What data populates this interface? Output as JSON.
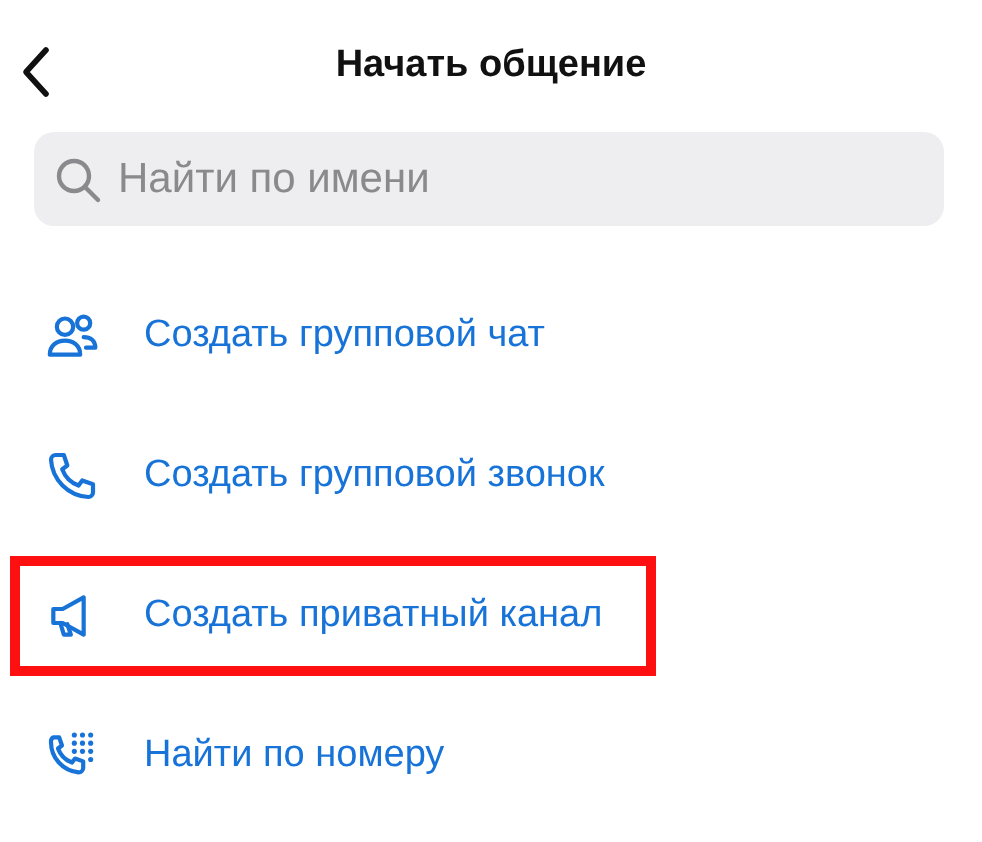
{
  "header": {
    "title": "Начать общение"
  },
  "search": {
    "placeholder": "Найти по имени"
  },
  "actions": [
    {
      "kind": "group",
      "label": "Создать групповой чат",
      "highlighted": false
    },
    {
      "kind": "call",
      "label": "Создать групповой звонок",
      "highlighted": false
    },
    {
      "kind": "channel",
      "label": "Создать приватный канал",
      "highlighted": true
    },
    {
      "kind": "dial",
      "label": "Найти по номеру",
      "highlighted": false
    }
  ]
}
